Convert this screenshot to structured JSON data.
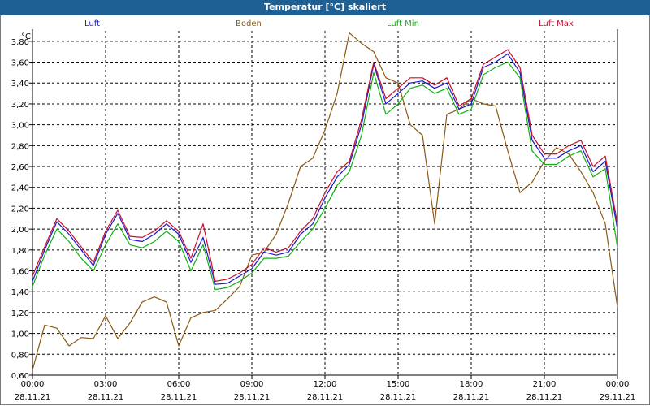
{
  "window": {
    "title": "Temperatur [°C] skaliert"
  },
  "legend": [
    {
      "label": "Luft",
      "color": "#1a1acc"
    },
    {
      "label": "Boden",
      "color": "#8b5a14"
    },
    {
      "label": "Luft Min",
      "color": "#10b010"
    },
    {
      "label": "Luft Max",
      "color": "#c8102e"
    }
  ],
  "chart_data": {
    "type": "line",
    "y_unit": "°C",
    "ylim": [
      0.6,
      3.9
    ],
    "yticks": [
      "0,60",
      "0,80",
      "1,00",
      "1,20",
      "1,40",
      "1,60",
      "1,80",
      "2,00",
      "2,20",
      "2,40",
      "2,60",
      "2,80",
      "3,00",
      "3,20",
      "3,40",
      "3,60",
      "3,80"
    ],
    "xlim_hours": [
      0,
      24
    ],
    "xticks": [
      {
        "time": "00:00",
        "date": "28.11.21"
      },
      {
        "time": "03:00",
        "date": "28.11.21"
      },
      {
        "time": "06:00",
        "date": "28.11.21"
      },
      {
        "time": "09:00",
        "date": "28.11.21"
      },
      {
        "time": "12:00",
        "date": "28.11.21"
      },
      {
        "time": "15:00",
        "date": "28.11.21"
      },
      {
        "time": "18:00",
        "date": "28.11.21"
      },
      {
        "time": "21:00",
        "date": "28.11.21"
      },
      {
        "time": "00:00",
        "date": "29.11.21"
      }
    ],
    "grid": true,
    "x": [
      0,
      0.5,
      1,
      1.5,
      2,
      2.5,
      3,
      3.5,
      4,
      4.5,
      5,
      5.5,
      6,
      6.5,
      7,
      7.5,
      8,
      8.5,
      9,
      9.5,
      10,
      10.5,
      11,
      11.5,
      12,
      12.5,
      13,
      13.5,
      14,
      14.5,
      15,
      15.5,
      16,
      16.5,
      17,
      17.5,
      18,
      18.5,
      19,
      19.5,
      20,
      20.5,
      21,
      21.5,
      22,
      22.5,
      23,
      23.5,
      24
    ],
    "series": [
      {
        "name": "Luft",
        "color": "#1a1acc",
        "values": [
          1.5,
          1.8,
          2.07,
          1.95,
          1.8,
          1.65,
          1.95,
          2.15,
          1.9,
          1.88,
          1.95,
          2.05,
          1.95,
          1.68,
          1.92,
          1.47,
          1.48,
          1.55,
          1.62,
          1.78,
          1.75,
          1.78,
          1.95,
          2.05,
          2.3,
          2.5,
          2.62,
          3.0,
          3.58,
          3.2,
          3.3,
          3.4,
          3.42,
          3.35,
          3.4,
          3.15,
          3.2,
          3.55,
          3.6,
          3.68,
          3.5,
          2.85,
          2.68,
          2.68,
          2.75,
          2.8,
          2.55,
          2.65,
          2.0
        ]
      },
      {
        "name": "Boden",
        "color": "#8b5a14",
        "values": [
          0.65,
          1.08,
          1.05,
          0.88,
          0.96,
          0.95,
          1.17,
          0.95,
          1.1,
          1.3,
          1.35,
          1.3,
          0.88,
          1.15,
          1.2,
          1.22,
          1.33,
          1.45,
          1.75,
          1.78,
          1.95,
          2.25,
          2.6,
          2.68,
          2.95,
          3.3,
          3.88,
          3.78,
          3.7,
          3.45,
          3.4,
          3.0,
          2.9,
          2.05,
          3.1,
          3.15,
          3.25,
          3.2,
          3.18,
          2.75,
          2.35,
          2.45,
          2.65,
          2.78,
          2.72,
          2.55,
          2.35,
          2.05,
          1.25
        ]
      },
      {
        "name": "Luft Min",
        "color": "#10b010",
        "values": [
          1.45,
          1.75,
          2.0,
          1.88,
          1.72,
          1.6,
          1.85,
          2.05,
          1.85,
          1.82,
          1.88,
          1.98,
          1.88,
          1.6,
          1.85,
          1.42,
          1.44,
          1.5,
          1.58,
          1.72,
          1.72,
          1.74,
          1.88,
          2.0,
          2.2,
          2.42,
          2.55,
          2.9,
          3.5,
          3.1,
          3.2,
          3.35,
          3.38,
          3.3,
          3.35,
          3.1,
          3.15,
          3.48,
          3.55,
          3.6,
          3.45,
          2.75,
          2.62,
          2.62,
          2.7,
          2.75,
          2.5,
          2.58,
          1.82
        ]
      },
      {
        "name": "Luft Max",
        "color": "#c8102e",
        "values": [
          1.55,
          1.83,
          2.1,
          1.98,
          1.83,
          1.68,
          1.98,
          2.18,
          1.93,
          1.92,
          1.98,
          2.08,
          1.98,
          1.72,
          2.05,
          1.5,
          1.52,
          1.58,
          1.66,
          1.82,
          1.78,
          1.82,
          1.98,
          2.1,
          2.35,
          2.55,
          2.65,
          3.05,
          3.6,
          3.25,
          3.35,
          3.45,
          3.45,
          3.38,
          3.45,
          3.18,
          3.25,
          3.58,
          3.65,
          3.72,
          3.55,
          2.9,
          2.72,
          2.72,
          2.8,
          2.85,
          2.6,
          2.7,
          2.05
        ]
      }
    ]
  }
}
